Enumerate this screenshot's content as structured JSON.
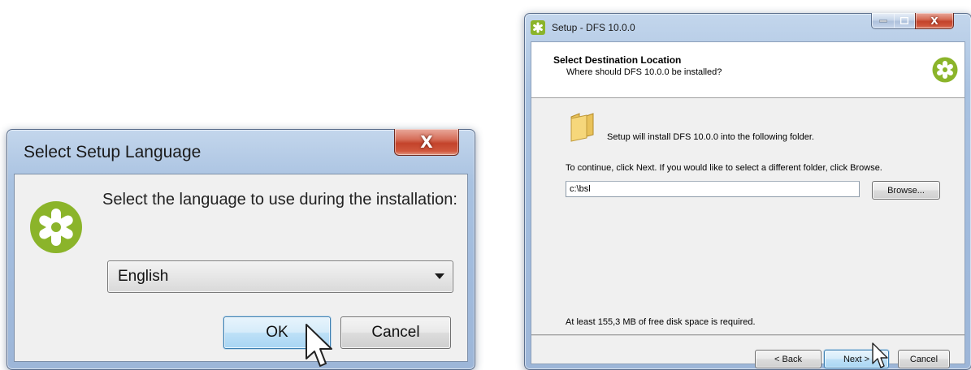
{
  "language_dialog": {
    "title": "Select Setup Language",
    "close_glyph": "X",
    "prompt": "Select the language to use during the installation:",
    "language_value": "English",
    "ok_label": "OK",
    "cancel_label": "Cancel",
    "logo_icon": "setup-logo-icon"
  },
  "setup_window": {
    "title": "Setup - DFS 10.0.0",
    "close_glyph": "X",
    "header_title": "Select Destination Location",
    "header_subtitle": "Where should DFS 10.0.0 be installed?",
    "install_text": "Setup will install DFS 10.0.0 into the following folder.",
    "continue_text": "To continue, click Next. If you would like to select a different folder, click Browse.",
    "path_value": "c:\\bsl",
    "browse_label": "Browse...",
    "space_text": "At least 155,3 MB of free disk space is required.",
    "back_label": "< Back",
    "next_label": "Next >",
    "cancel_label": "Cancel"
  },
  "colors": {
    "logo_green": "#8bb42a",
    "frame_blue": "#a9c2e1",
    "close_red": "#c3432b"
  }
}
